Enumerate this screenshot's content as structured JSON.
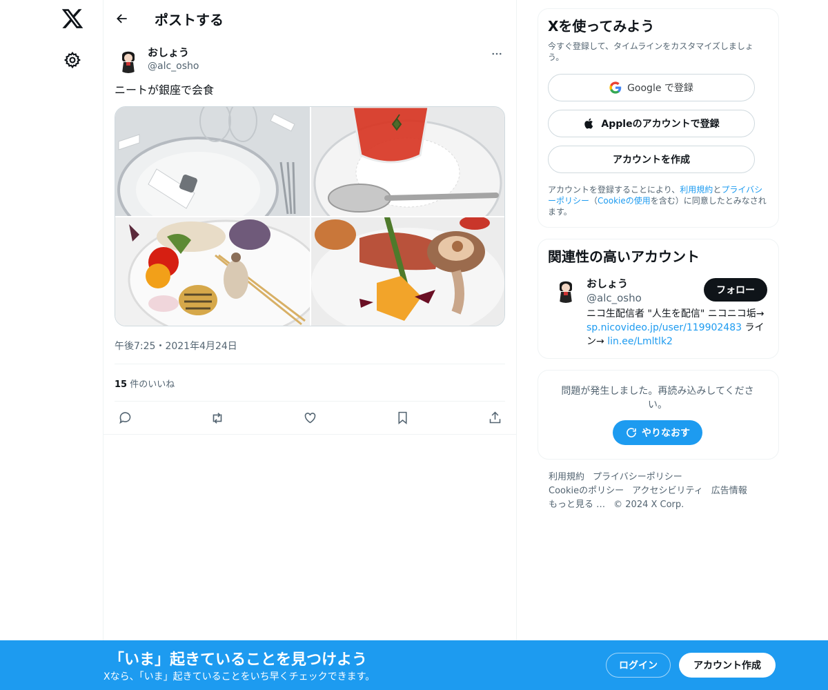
{
  "header": {
    "title": "ポストする"
  },
  "post": {
    "author_name": "おしょう",
    "author_handle": "@alc_osho",
    "text": "ニートが銀座で会食",
    "timestamp": "午後7:25・2021年4月24日",
    "likes_count": "15",
    "likes_label": " 件のいいね"
  },
  "signup": {
    "title": "Xを使ってみよう",
    "subtitle": "今すぐ登録して、タイムラインをカスタマイズしましょう。",
    "google_label": "Google で登録",
    "apple_label": "Appleのアカウントで登録",
    "create_label": "アカウントを作成",
    "legal_prefix": "アカウントを登録することにより、",
    "terms_link": "利用規約",
    "legal_and": "と",
    "privacy_link": "プライバシーポリシー",
    "legal_paren_open": "（",
    "cookie_link": "Cookieの使用",
    "legal_suffix": "を含む）に同意したとみなされます。"
  },
  "related": {
    "title": "関連性の高いアカウント",
    "name": "おしょう",
    "handle": "@alc_osho",
    "follow_label": "フォロー",
    "bio_prefix": "ニコ生配信者 \"人生を配信\" ニコニコ垢→ ",
    "bio_link1": "sp.nicovideo.jp/user/119902483",
    "bio_mid": " ライン→ ",
    "bio_link2": "lin.ee/Lmltlk2"
  },
  "error": {
    "message": "問題が発生しました。再読み込みしてください。",
    "retry_label": "やりなおす"
  },
  "footer": {
    "links": [
      "利用規約",
      "プライバシーポリシー",
      "Cookieのポリシー",
      "アクセシビリティ",
      "広告情報",
      "もっと見る …",
      "© 2024 X Corp."
    ]
  },
  "banner": {
    "title": "「いま」起きていることを見つけよう",
    "subtitle": "Xなら、「いま」起きていることをいち早くチェックできます。",
    "login_label": "ログイン",
    "signup_label": "アカウント作成"
  },
  "colors": {
    "accent": "#1d9bf0",
    "text": "#0f1419",
    "secondary": "#536471"
  }
}
